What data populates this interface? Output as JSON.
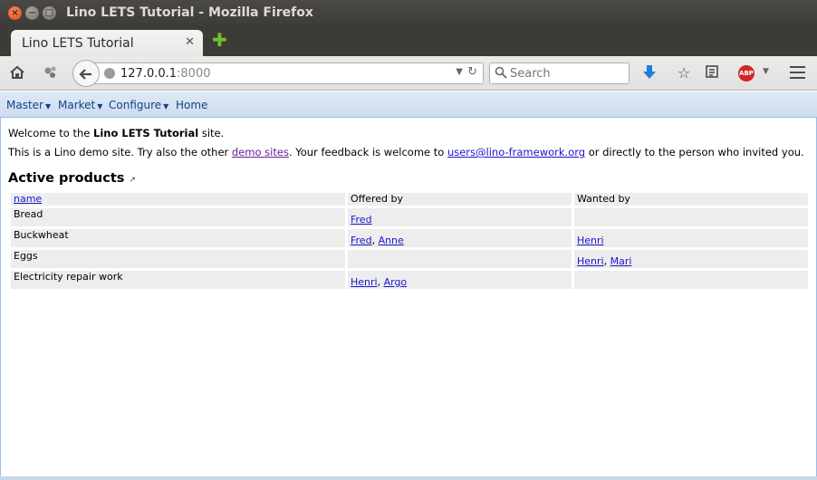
{
  "window": {
    "title": "Lino LETS Tutorial - Mozilla Firefox"
  },
  "browser": {
    "tab_title": "Lino LETS Tutorial",
    "url_host": "127.0.0.1",
    "url_port": ":8000",
    "search_placeholder": "Search",
    "icons": [
      "home-icon",
      "apps-icon",
      "back-icon",
      "globe-icon",
      "reload-icon",
      "search-icon",
      "download-icon",
      "bookmark-star-icon",
      "reading-list-icon",
      "adblock-icon",
      "hamburger-menu-icon"
    ],
    "adblock_label": "ABP"
  },
  "page_menu": {
    "items": [
      {
        "label": "Master",
        "has_dropdown": true
      },
      {
        "label": "Market",
        "has_dropdown": true
      },
      {
        "label": "Configure",
        "has_dropdown": true
      },
      {
        "label": "Home",
        "has_dropdown": false
      }
    ]
  },
  "content": {
    "welcome_prefix": "Welcome to the ",
    "welcome_site": "Lino LETS Tutorial",
    "welcome_suffix": " site.",
    "intro_prefix": "This is a Lino demo site. Try also the other ",
    "intro_link": "demo sites",
    "intro_middle": ". Your feedback is welcome to ",
    "intro_email": "users@lino-framework.org",
    "intro_suffix": " or directly to the person who invited you.",
    "section_title": "Active products",
    "section_ext_icon": "external-link-icon"
  },
  "table": {
    "headers": {
      "name": "name",
      "offered": "Offered by",
      "wanted": "Wanted by"
    },
    "rows": [
      {
        "name": "Bread",
        "offered": [
          "Fred"
        ],
        "wanted": []
      },
      {
        "name": "Buckwheat",
        "offered": [
          "Fred",
          "Anne"
        ],
        "wanted": [
          "Henri"
        ]
      },
      {
        "name": "Eggs",
        "offered": [],
        "wanted": [
          "Henri",
          "Mari"
        ]
      },
      {
        "name": "Electricity repair work",
        "offered": [
          "Henri",
          "Argo"
        ],
        "wanted": []
      }
    ]
  },
  "colors": {
    "link": "#1c14cc",
    "visited_link": "#6a1b9a",
    "menu_text": "#15428b",
    "menu_bg": "#dfe9f6",
    "cell_bg": "#ededed"
  }
}
